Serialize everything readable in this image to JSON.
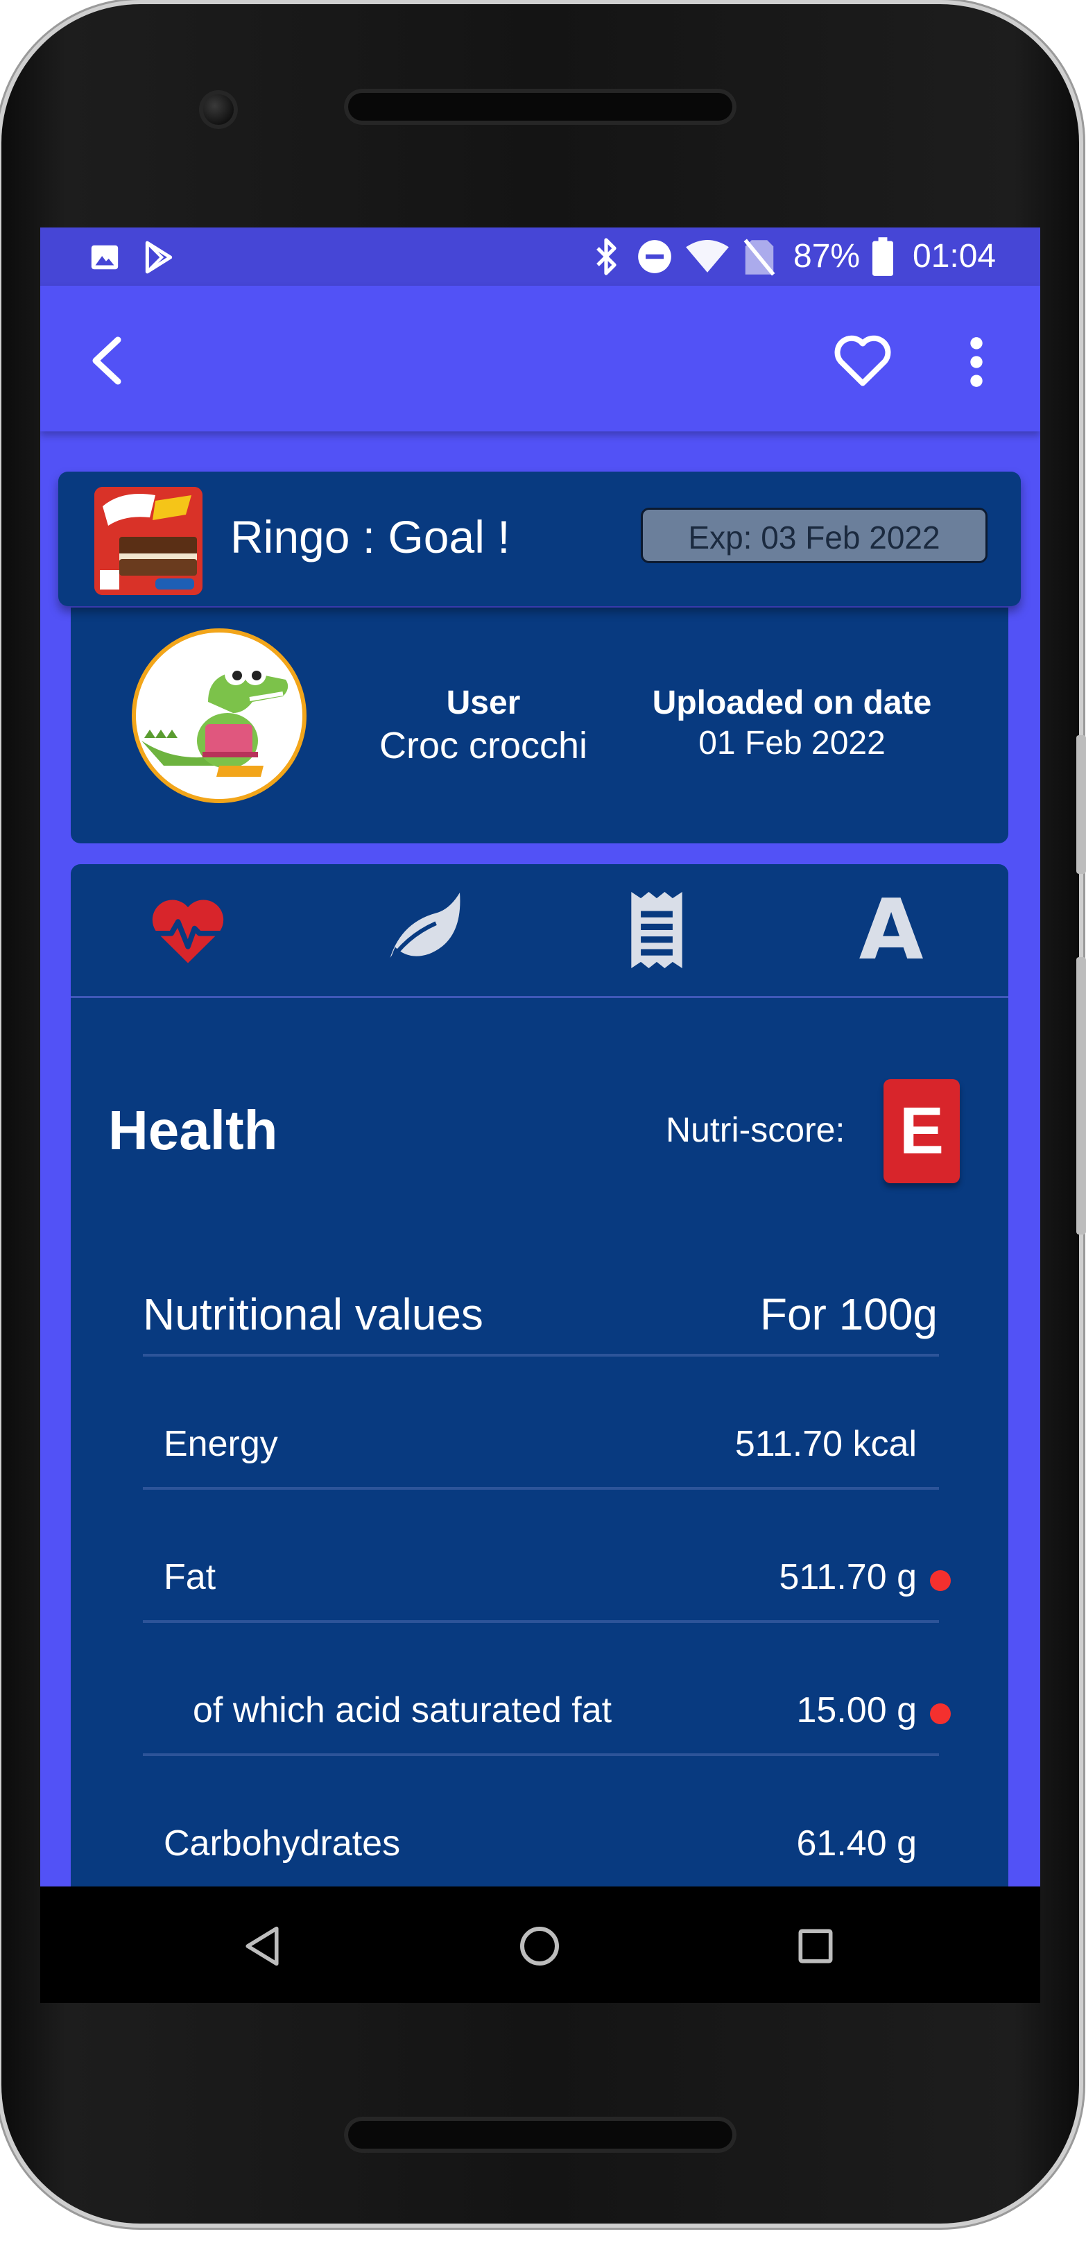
{
  "status_bar": {
    "battery_percent": "87%",
    "time": "01:04",
    "icons": [
      "image-icon",
      "play-store-icon",
      "bluetooth-icon",
      "dnd-icon",
      "wifi-icon",
      "no-sim-icon",
      "battery-icon"
    ]
  },
  "app_bar": {
    "icons": [
      "back-arrow-icon",
      "heart-outline-icon",
      "more-vert-icon"
    ]
  },
  "product": {
    "name": "Ringo : Goal !",
    "expiry": "Exp: 03 Feb 2022"
  },
  "uploader": {
    "user_label": "User",
    "user_value": "Croc crocchi",
    "date_label": "Uploaded on date",
    "date_value": "01 Feb 2022"
  },
  "tabs": [
    {
      "icon": "heart-pulse-icon",
      "color": "#D8252B"
    },
    {
      "icon": "leaf-icon",
      "color": "#D9DEE8"
    },
    {
      "icon": "receipt-icon",
      "color": "#D9DEE8"
    },
    {
      "icon": "letter-a-icon",
      "label": "A",
      "color": "#D9DEE8"
    }
  ],
  "health": {
    "title": "Health",
    "nutri_label": "Nutri-score:",
    "nutri_grade": "E",
    "nutri_color": "#D8252B"
  },
  "nutrition": {
    "header_left": "Nutritional values",
    "header_right": "For 100g",
    "rows": [
      {
        "name": "Energy",
        "value": "511.70 kcal",
        "warning": false
      },
      {
        "name": "Fat",
        "value": "511.70 g",
        "warning": true
      },
      {
        "name": "of which acid saturated fat",
        "value": "15.00 g",
        "warning": true
      },
      {
        "name": "Carbohydrates",
        "value": "61.40 g",
        "warning": false
      }
    ]
  },
  "nav_bar": {
    "icons": [
      "back-triangle-icon",
      "home-circle-icon",
      "recents-square-icon"
    ]
  },
  "colors": {
    "primary": "#5252F6",
    "status_bar": "#4646D6",
    "card": "#083A80",
    "warning_dot": "#F4302E"
  }
}
